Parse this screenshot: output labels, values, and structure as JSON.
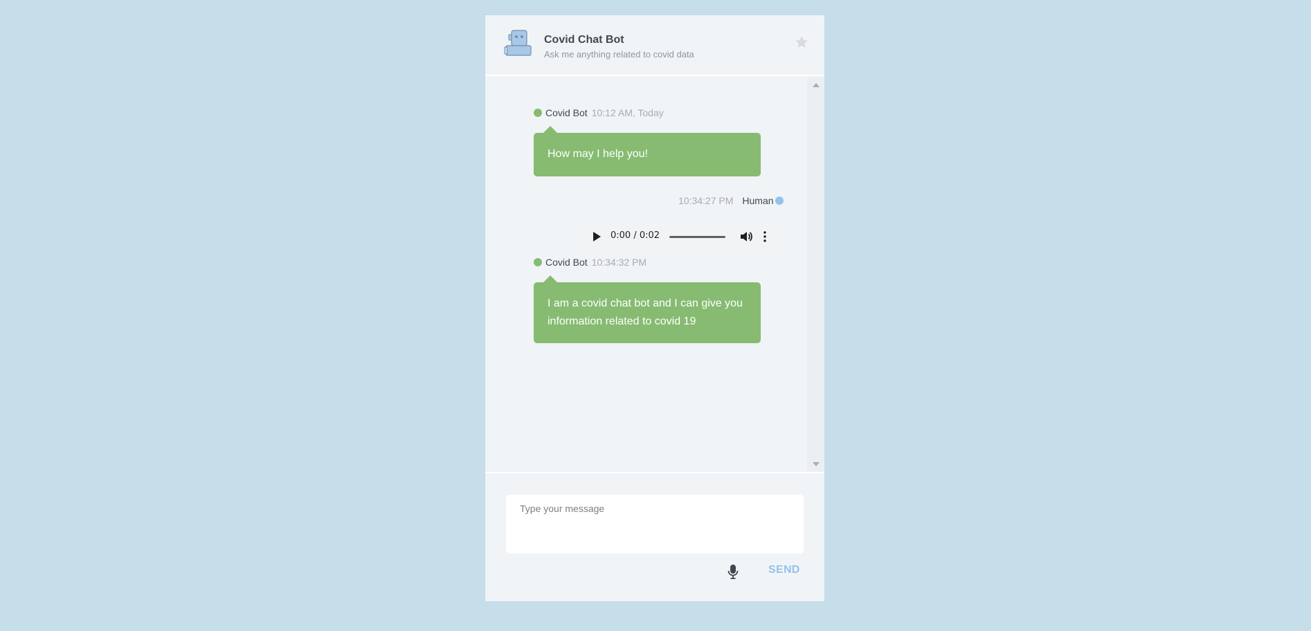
{
  "header": {
    "title": "Covid Chat Bot",
    "subtitle": "Ask me anything related to covid data",
    "avatar_icon": "robot-icon",
    "favorite_icon": "star-icon"
  },
  "messages": [
    {
      "sender": "Covid Bot",
      "time": "10:12 AM, Today",
      "text": "How may I help you!",
      "type": "bot"
    },
    {
      "sender": "Human",
      "time": "10:34:27 PM",
      "type": "human-audio",
      "audio": {
        "current": "0:00",
        "duration": "0:02",
        "display": "0:00 / 0:02"
      }
    },
    {
      "sender": "Covid Bot",
      "time": "10:34:32 PM",
      "text": "I am a covid chat bot and I can give you information related to covid 19",
      "type": "bot"
    }
  ],
  "composer": {
    "placeholder": "Type your message",
    "value": "",
    "mic_icon": "microphone-icon",
    "send_label": "SEND"
  },
  "colors": {
    "page_background": "#c6ddea",
    "panel_background": "#f1f4f7",
    "bot_bubble": "#86bb71",
    "human_dot": "#94c2ed",
    "send": "#94c2ed"
  }
}
